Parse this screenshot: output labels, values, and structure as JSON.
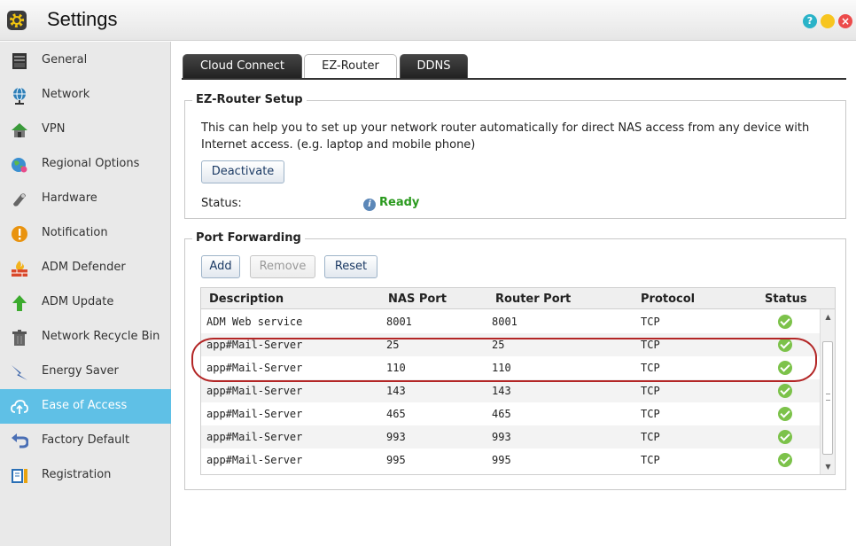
{
  "window": {
    "title": "Settings"
  },
  "sidebar": {
    "items": [
      {
        "label": "General",
        "icon": "server-icon"
      },
      {
        "label": "Network",
        "icon": "globe-network-icon"
      },
      {
        "label": "VPN",
        "icon": "vpn-house-icon"
      },
      {
        "label": "Regional Options",
        "icon": "globe-pin-icon"
      },
      {
        "label": "Hardware",
        "icon": "hardware-icon"
      },
      {
        "label": "Notification",
        "icon": "exclamation-icon"
      },
      {
        "label": "ADM Defender",
        "icon": "firewall-icon"
      },
      {
        "label": "ADM Update",
        "icon": "up-arrow-icon"
      },
      {
        "label": "Network Recycle Bin",
        "icon": "trash-icon"
      },
      {
        "label": "Energy Saver",
        "icon": "energy-icon"
      },
      {
        "label": "Ease of Access",
        "icon": "cloud-upload-icon"
      },
      {
        "label": "Factory Default",
        "icon": "undo-arrow-icon"
      },
      {
        "label": "Registration",
        "icon": "registration-icon"
      }
    ],
    "active": "Ease of Access"
  },
  "tabs": [
    {
      "label": "Cloud Connect"
    },
    {
      "label": "EZ-Router"
    },
    {
      "label": "DDNS"
    }
  ],
  "ez_router": {
    "legend": "EZ-Router Setup",
    "description": "This can help you to set up your network router automatically for direct NAS access from any device with Internet access. (e.g. laptop and mobile phone)",
    "deactivate_label": "Deactivate",
    "status_label": "Status:",
    "status_value": "Ready"
  },
  "port_forwarding": {
    "legend": "Port Forwarding",
    "buttons": {
      "add": "Add",
      "remove": "Remove",
      "reset": "Reset"
    },
    "columns": [
      "Description",
      "NAS Port",
      "Router Port",
      "Protocol",
      "Status"
    ],
    "rows": [
      {
        "description": "ADM Web service",
        "nas_port": "8001",
        "router_port": "8001",
        "protocol": "TCP"
      },
      {
        "description": "app#Mail-Server",
        "nas_port": "25",
        "router_port": "25",
        "protocol": "TCP"
      },
      {
        "description": "app#Mail-Server",
        "nas_port": "110",
        "router_port": "110",
        "protocol": "TCP"
      },
      {
        "description": "app#Mail-Server",
        "nas_port": "143",
        "router_port": "143",
        "protocol": "TCP"
      },
      {
        "description": "app#Mail-Server",
        "nas_port": "465",
        "router_port": "465",
        "protocol": "TCP"
      },
      {
        "description": "app#Mail-Server",
        "nas_port": "993",
        "router_port": "993",
        "protocol": "TCP"
      },
      {
        "description": "app#Mail-Server",
        "nas_port": "995",
        "router_port": "995",
        "protocol": "TCP"
      }
    ]
  },
  "colors": {
    "accent": "#5fc0e6",
    "ready": "#2b9a1f",
    "highlight": "#b32626"
  }
}
